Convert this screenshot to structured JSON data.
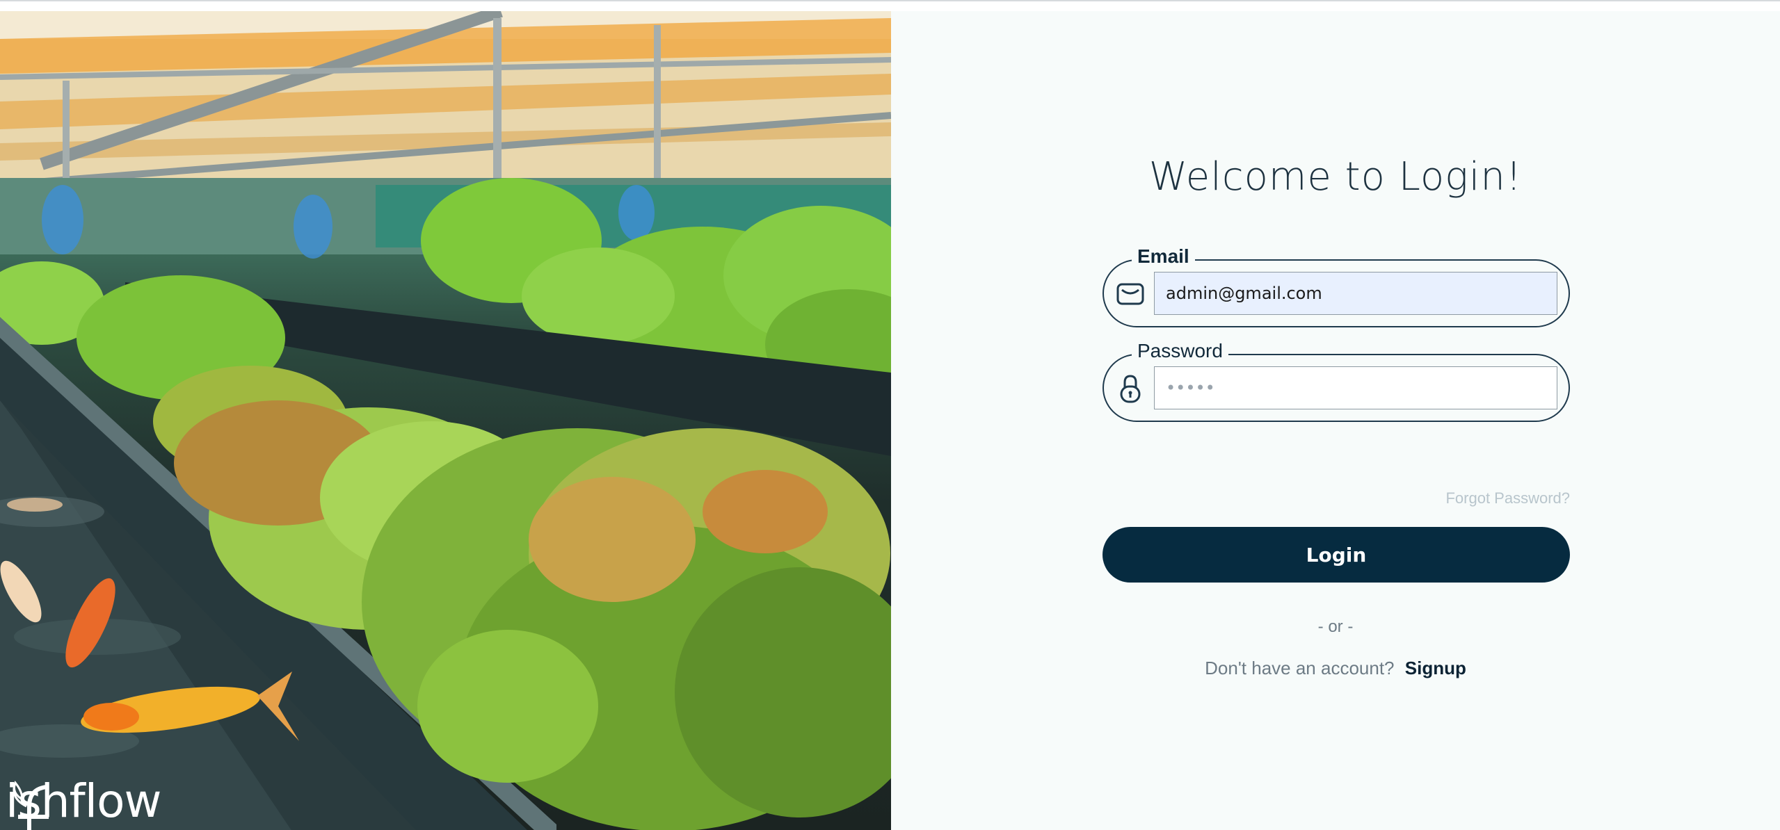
{
  "brand": {
    "name": "ishflow",
    "logo_mark": "fish-f-logo"
  },
  "login": {
    "title": "Welcome to Login!",
    "email": {
      "label": "Email",
      "value": "admin@gmail.com",
      "icon": "envelope-icon"
    },
    "password": {
      "label": "Password",
      "value": "•••••",
      "icon": "padlock-icon"
    },
    "forgot_label": "Forgot Password?",
    "submit_label": "Login",
    "separator": "- or -",
    "signup_prompt": "Don't have an account?",
    "signup_label": "Signup"
  },
  "colors": {
    "primary": "#062b40",
    "panel_bg": "#f7fbfa",
    "border": "#1f3a4d",
    "autofill_bg": "#e8f0fe"
  }
}
